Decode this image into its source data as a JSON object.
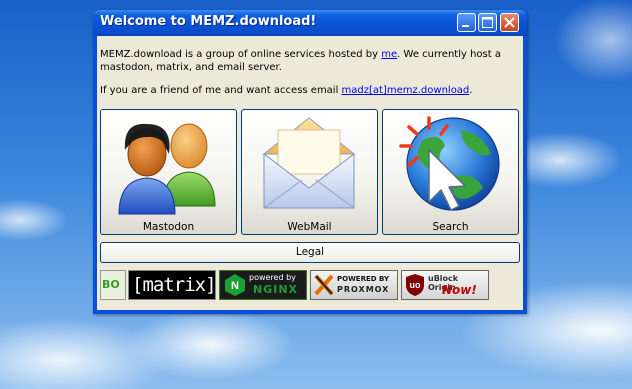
{
  "window": {
    "title": "Welcome to MEMZ.download!"
  },
  "intro": {
    "line1_before": "MEMZ.download is a group of online services hosted by ",
    "line1_link": "me",
    "line1_after": ". We currently host a mastodon, matrix, and email server.",
    "line2_before": "If you are a friend of me and want access email ",
    "line2_link": "madz[at]memz.download",
    "line2_after": "."
  },
  "tiles": [
    {
      "label": "Mastodon",
      "icon": "users-icon"
    },
    {
      "label": "WebMail",
      "icon": "envelope-icon"
    },
    {
      "label": "Search",
      "icon": "globe-cursor-icon"
    }
  ],
  "legal": {
    "label": "Legal"
  },
  "badges": {
    "first": "BO",
    "matrix": "[matrix]",
    "nginx_top": "powered by",
    "nginx_bottom": "NGINX",
    "proxmox_top": "POWERED BY",
    "proxmox_bottom": "PROXMOX",
    "ublock_top": "uBlock Origin",
    "ublock_bottom": "Now!"
  },
  "colors": {
    "titlebar": "#0a52d6",
    "client": "#ece9d8",
    "link": "#0000ee",
    "close_button": "#c8431e"
  }
}
